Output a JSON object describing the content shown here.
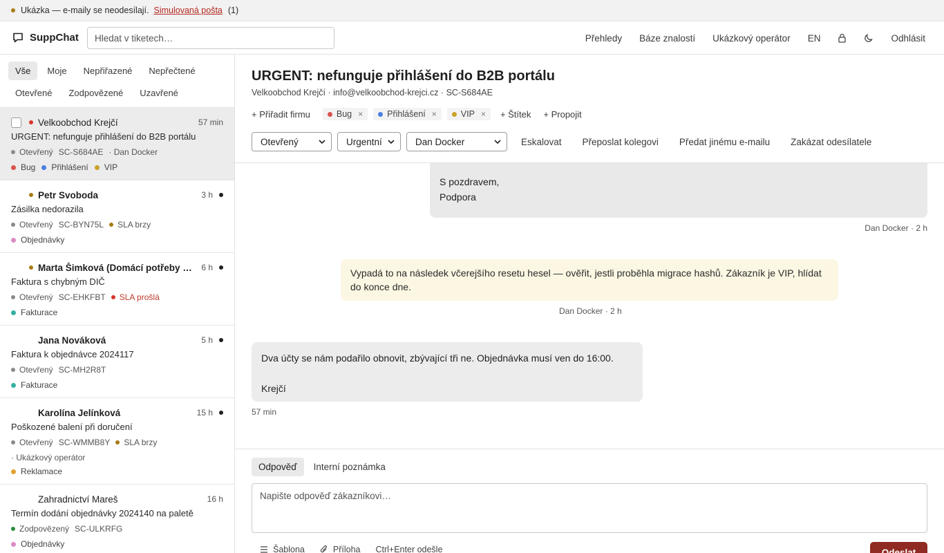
{
  "banner": {
    "text": "Ukázka — e-maily se neodesílají.",
    "link": "Simulovaná pošta",
    "count": "(1)"
  },
  "header": {
    "brand": "SuppChat",
    "search_placeholder": "Hledat v tiketech…",
    "nav": {
      "overviews": "Přehledy",
      "knowledge_base": "Báze znalostí",
      "operator": "Ukázkový operátor",
      "lang": "EN",
      "logout": "Odhlásit"
    }
  },
  "filters": {
    "all": "Vše",
    "mine": "Moje",
    "unassigned": "Nepřiřazené",
    "unread": "Nepřečtené",
    "open": "Otevřené",
    "answered": "Zodpovězené",
    "closed": "Uzavřené"
  },
  "tickets": [
    {
      "name": "Velkoobchod Krejčí",
      "time": "57 min",
      "subject": "URGENT: nefunguje přihlášení do B2B portálu",
      "status": "Otevřený",
      "id": "SC-S684AE",
      "assignee": "· Dan Docker",
      "tags": [
        "Bug",
        "Přihlášení",
        "VIP"
      ]
    },
    {
      "name": "Petr Svoboda",
      "time": "3 h",
      "subject": "Zásilka nedorazila",
      "status": "Otevřený",
      "id": "SC-BYN75L",
      "sla": "SLA brzy",
      "tags": [
        "Objednávky"
      ]
    },
    {
      "name": "Marta Šimková (Domácí potřeby K...",
      "time": "6 h",
      "subject": "Faktura s chybným DIČ",
      "status": "Otevřený",
      "id": "SC-EHKFBT",
      "sla": "SLA prošlá",
      "tags": [
        "Fakturace"
      ]
    },
    {
      "name": "Jana Nováková",
      "time": "5 h",
      "subject": "Faktura k objednávce 2024117",
      "status": "Otevřený",
      "id": "SC-MH2R8T",
      "tags": [
        "Fakturace"
      ]
    },
    {
      "name": "Karolína Jelínková",
      "time": "15 h",
      "subject": "Poškozené balení při doručení",
      "status": "Otevřený",
      "id": "SC-WMMB8Y",
      "sla": "SLA brzy",
      "assignee": "· Ukázkový operátor",
      "tags": [
        "Reklamace"
      ]
    },
    {
      "name": "Zahradnictví Mareš",
      "time": "16 h",
      "subject": "Termín dodání objednávky 2024140 na paletě",
      "status": "Zodpovězený",
      "id": "SC-ULKRFG",
      "tags": [
        "Objednávky"
      ]
    }
  ],
  "ticket": {
    "title": "URGENT: nefunguje přihlášení do B2B portálu",
    "subtitle": "Velkoobchod Krejčí · info@velkoobchod-krejci.cz · SC-S684AE",
    "assign_company": "+ Přiřadit firmu",
    "tags": [
      "Bug",
      "Přihlášení",
      "VIP"
    ],
    "tag_remove": "×",
    "add_tag": "+ Štítek",
    "link": "+ Propojit",
    "status": "Otevřený",
    "priority": "Urgentní",
    "assignee": "Dan Docker",
    "escalate": "Eskalovat",
    "forward_colleague": "Přeposlat kolegovi",
    "forward_email": "Předat jinému e-mailu",
    "block_sender": "Zakázat odesílatele"
  },
  "messages": {
    "out_line1": "S pozdravem,",
    "out_line2": "Podpora",
    "out_meta": "Dan Docker · 2 h",
    "note_text": "Vypadá to na následek včerejšího resetu hesel — ověřit, jestli proběhla migrace hashů. Zákazník je VIP, hlídat do konce dne.",
    "note_meta": "Dan Docker · 2 h",
    "in_line1": "Dva účty se nám podařilo obnovit, zbývající tři ne. Objednávka musí ven do 16:00.",
    "in_line2": "Krejčí",
    "in_meta": "57 min"
  },
  "composer": {
    "tab_reply": "Odpověď",
    "tab_note": "Interní poznámka",
    "placeholder": "Napište odpověď zákazníkovi…",
    "template": "Šablona",
    "attachment": "Příloha",
    "shortcut": "Ctrl+Enter odešle",
    "send": "Odeslat"
  },
  "colors": {
    "bug": "#d9534f",
    "login": "#4a7fe0",
    "vip": "#c9a227",
    "orders": "#d98cc4",
    "billing": "#35b0a0",
    "complaint": "#e0a030",
    "send": "#8f2b22"
  }
}
